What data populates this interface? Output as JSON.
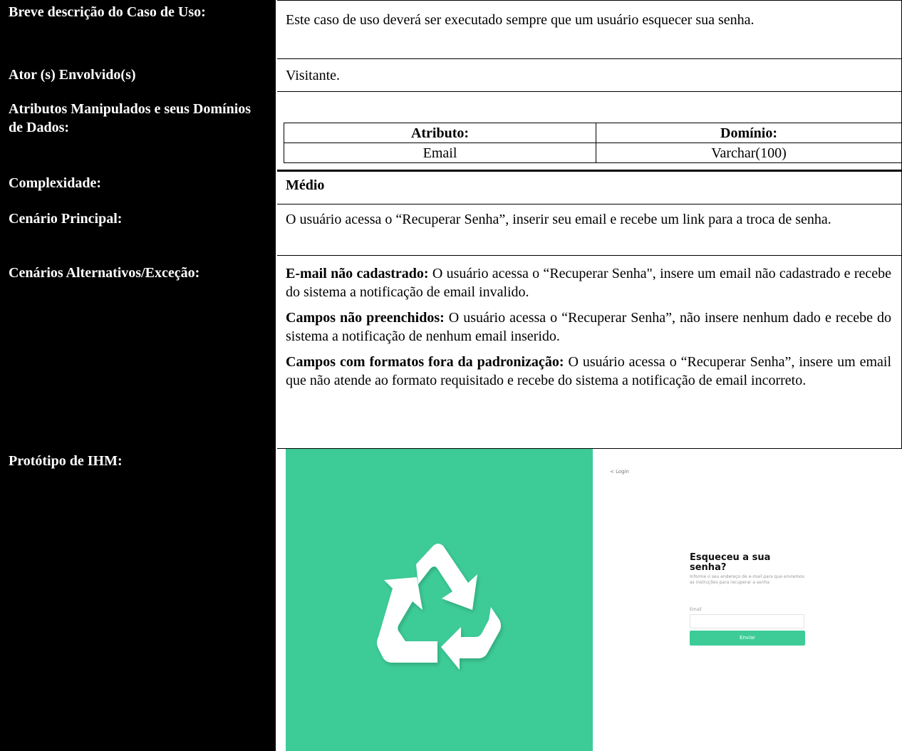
{
  "rows": {
    "breve": {
      "label": "Breve descrição do Caso de Uso:",
      "value": "Este caso de uso deverá ser executado sempre que um usuário esquecer sua senha."
    },
    "ator": {
      "label": "Ator (s) Envolvido(s)",
      "value": "Visitante."
    },
    "atributos": {
      "label": "Atributos Manipulados e seus Domínios de Dados:",
      "table": {
        "headers": [
          "Atributo:",
          "Domínio:"
        ],
        "rows": [
          [
            "Email",
            "Varchar(100)"
          ]
        ]
      }
    },
    "complexidade": {
      "label": "Complexidade:",
      "value": "Médio"
    },
    "cenario_principal": {
      "label": "Cenário Principal:",
      "value": "O usuário acessa o “Recuperar Senha”, inserir seu email e recebe um link para a troca de senha."
    },
    "alternativos": {
      "label": "Cenários Alternativos/Exceção:",
      "items": [
        {
          "title": "E-mail não cadastrado:",
          "text": " O usuário acessa o “Recuperar Senha\",  insere um email não cadastrado e recebe do sistema a notificação de email invalido."
        },
        {
          "title": "Campos não preenchidos:",
          "text": " O usuário acessa o “Recuperar Senha”, não insere nenhum dado e recebe do sistema a notificação de nenhum email inserido."
        },
        {
          "title": "Campos com formatos fora da padronização:",
          "text": " O usuário acessa o “Recuperar Senha”, insere um email que não atende ao formato requisitado e recebe do sistema a notificação de email incorreto."
        }
      ]
    },
    "prototipo": {
      "label": "Protótipo de IHM:"
    }
  },
  "prototype": {
    "back_link": "< Login",
    "title": "Esqueceu a sua senha?",
    "description": "Informe o seu endereço de e-mail para que enviemos as instruções para recuperar a senha",
    "email_label": "Email",
    "email_value": "",
    "button_label": "Enviar",
    "icon": "recycle-icon",
    "colors": {
      "accent": "#3dcc98",
      "label_bg": "#000000"
    }
  }
}
